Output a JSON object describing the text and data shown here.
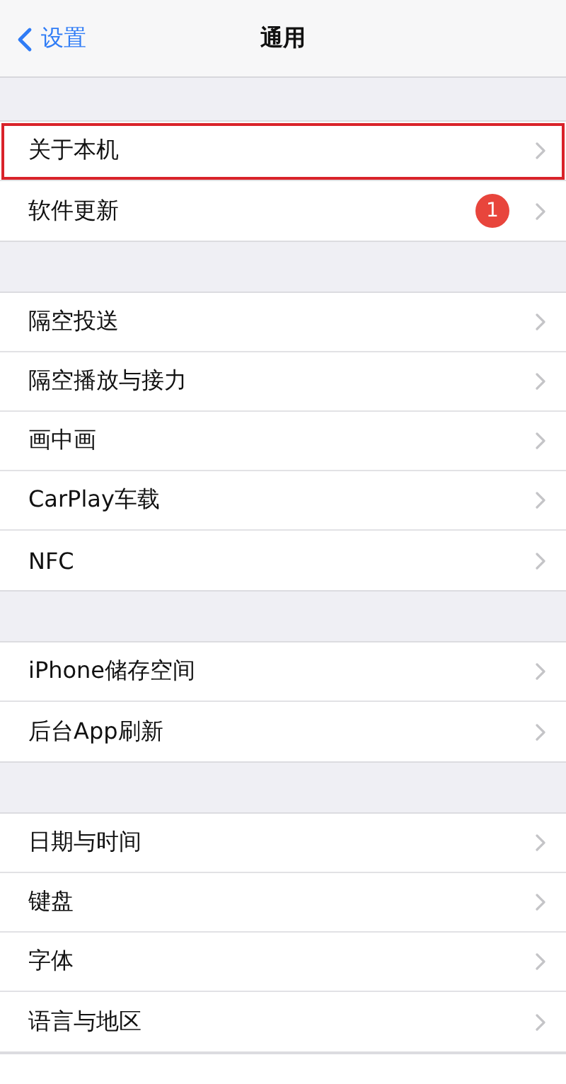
{
  "nav": {
    "back_label": "设置",
    "title": "通用"
  },
  "groups": [
    {
      "items": [
        {
          "label": "关于本机",
          "highlighted": true
        },
        {
          "label": "软件更新",
          "badge": "1",
          "highlighted": false
        }
      ]
    },
    {
      "items": [
        {
          "label": "隔空投送",
          "highlighted": false
        },
        {
          "label": "隔空播放与接力",
          "highlighted": false
        },
        {
          "label": "画中画",
          "highlighted": false
        },
        {
          "label": "CarPlay车载",
          "highlighted": false
        },
        {
          "label": "NFC",
          "highlighted": false
        }
      ]
    },
    {
      "items": [
        {
          "label": "iPhone储存空间",
          "highlighted": false
        },
        {
          "label": "后台App刷新",
          "highlighted": false
        }
      ]
    },
    {
      "items": [
        {
          "label": "日期与时间",
          "highlighted": false
        },
        {
          "label": "键盘",
          "highlighted": false
        },
        {
          "label": "字体",
          "highlighted": false
        },
        {
          "label": "语言与地区",
          "highlighted": false
        }
      ]
    }
  ]
}
